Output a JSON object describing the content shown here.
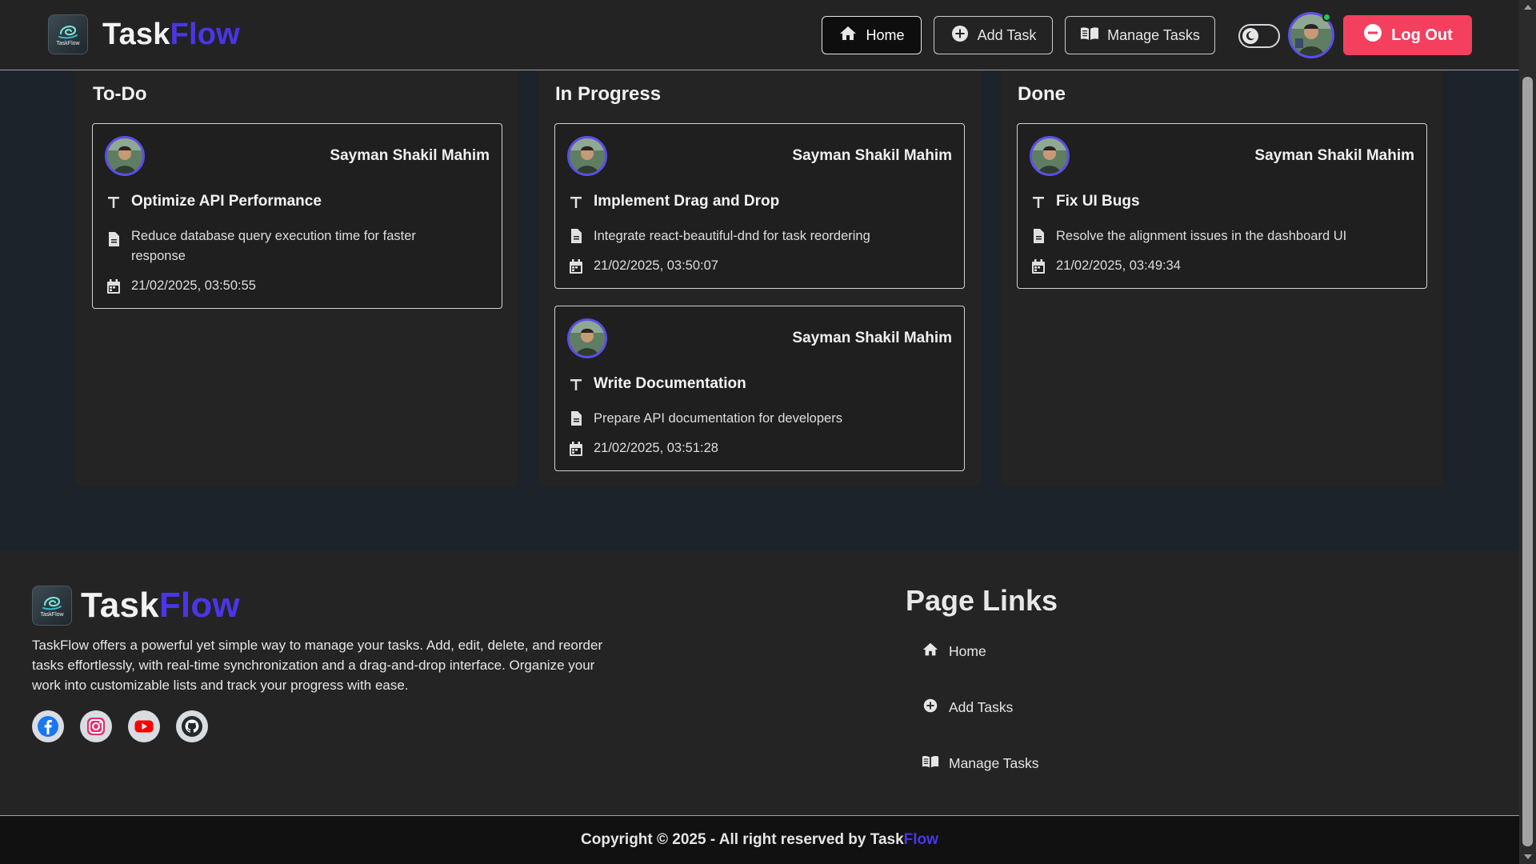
{
  "colors": {
    "accent": "#4a36e8",
    "logout": "#f43f5e",
    "online": "#22c55e",
    "avatar_ring": "#5b4ee8"
  },
  "brand": {
    "name_part1": "Task",
    "name_part2": "Flow",
    "logo_text": "TaskFlow"
  },
  "nav": {
    "home": "Home",
    "add_task": "Add Task",
    "manage_tasks": "Manage Tasks",
    "logout": "Log Out",
    "icons": {
      "home": "home-icon",
      "add": "plus-circle-icon",
      "manage": "book-open-icon",
      "theme": "moon-icon",
      "logout": "minus-circle-icon"
    }
  },
  "board": {
    "columns": [
      {
        "title": "To-Do",
        "cards": [
          {
            "owner": "Sayman Shakil Mahim",
            "title": "Optimize API Performance",
            "description": "Reduce database query execution time for faster response",
            "date": "21/02/2025, 03:50:55"
          }
        ]
      },
      {
        "title": "In Progress",
        "cards": [
          {
            "owner": "Sayman Shakil Mahim",
            "title": "Implement Drag and Drop",
            "description": "Integrate react-beautiful-dnd for task reordering",
            "date": "21/02/2025, 03:50:07"
          },
          {
            "owner": "Sayman Shakil Mahim",
            "title": "Write Documentation",
            "description": "Prepare API documentation for developers",
            "date": "21/02/2025, 03:51:28"
          }
        ]
      },
      {
        "title": "Done",
        "cards": [
          {
            "owner": "Sayman Shakil Mahim",
            "title": "Fix UI Bugs",
            "description": "Resolve the alignment issues in the dashboard UI",
            "date": "21/02/2025, 03:49:34"
          }
        ]
      }
    ]
  },
  "footer": {
    "about": "TaskFlow offers a powerful yet simple way to manage your tasks. Add, edit, delete, and reorder tasks effortlessly, with real-time synchronization and a drag-and-drop interface. Organize your work into customizable lists and track your progress with ease.",
    "links_title": "Page Links",
    "links": [
      "Home",
      "Add Tasks",
      "Manage Tasks"
    ],
    "socials": [
      "facebook-icon",
      "instagram-icon",
      "youtube-icon",
      "github-icon"
    ],
    "copyright_prefix": "Copyright © 2025 - All right reserved by ",
    "copyright_brand1": "Task",
    "copyright_brand2": "Flow"
  }
}
